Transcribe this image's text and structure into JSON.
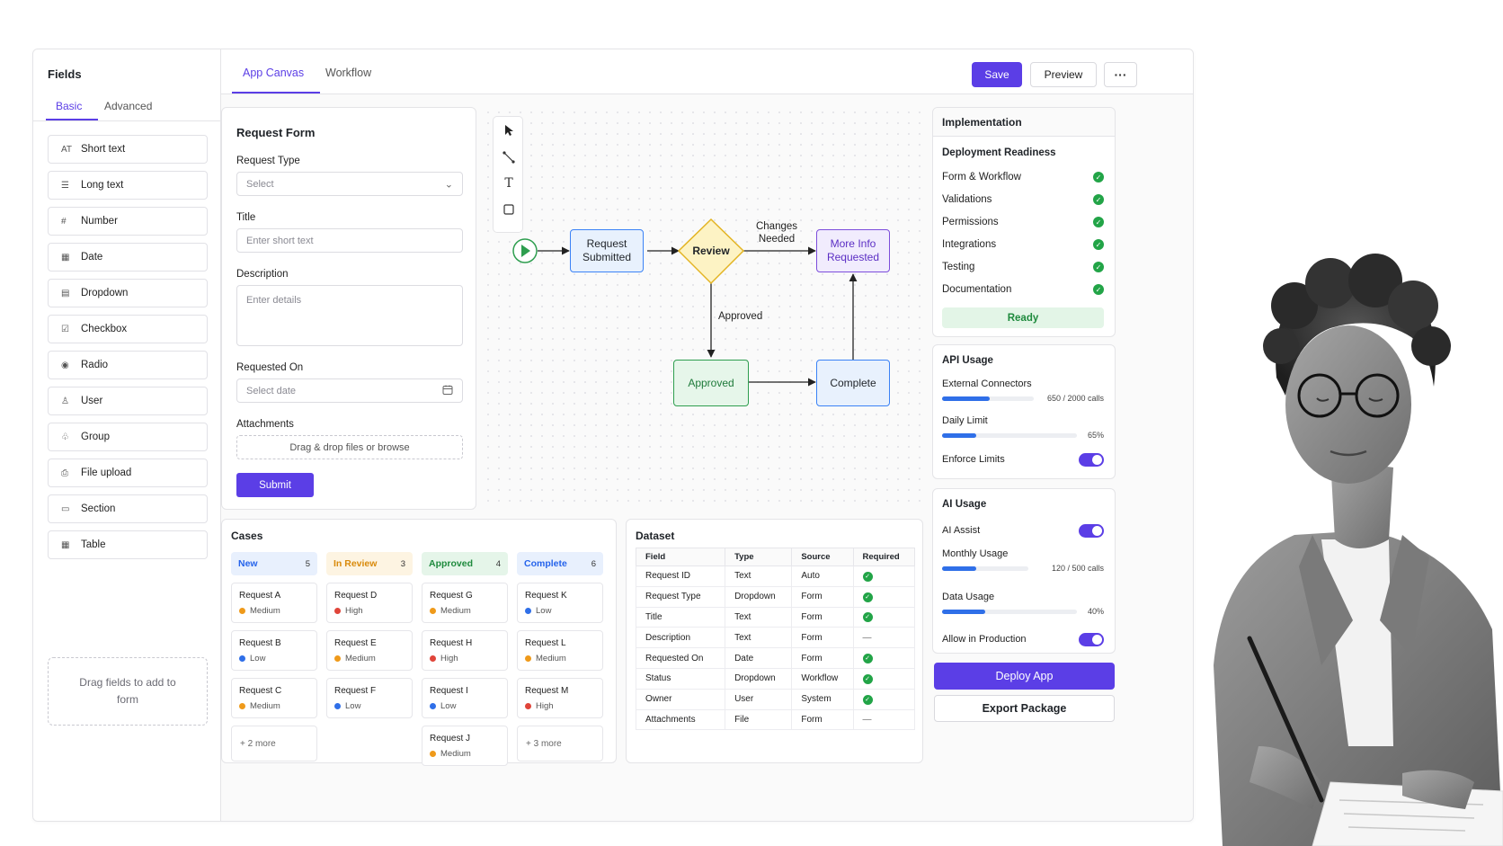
{
  "sidebar": {
    "title": "Fields",
    "tabs": [
      {
        "label": "Basic"
      },
      {
        "label": "Advanced"
      }
    ],
    "fields": [
      {
        "icon": "AT",
        "label": "Short text"
      },
      {
        "icon": "☰",
        "label": "Long text"
      },
      {
        "icon": "#",
        "label": "Number"
      },
      {
        "icon": "▦",
        "label": "Date"
      },
      {
        "icon": "▤",
        "label": "Dropdown"
      },
      {
        "icon": "☑",
        "label": "Checkbox"
      },
      {
        "icon": "◉",
        "label": "Radio"
      },
      {
        "icon": "♙",
        "label": "User"
      },
      {
        "icon": "♧",
        "label": "Group"
      },
      {
        "icon": "⎙",
        "label": "File upload"
      },
      {
        "icon": "▭",
        "label": "Section"
      },
      {
        "icon": "▦",
        "label": "Table"
      }
    ],
    "drop_zone": "Drag fields to add to form"
  },
  "header": {
    "tabs": [
      {
        "label": "App Canvas"
      },
      {
        "label": "Workflow"
      }
    ],
    "save_label": "Save",
    "preview_label": "Preview",
    "more_label": "···"
  },
  "form": {
    "title": "Request Form",
    "request_type": {
      "label": "Request Type",
      "placeholder": "Select"
    },
    "title_field": {
      "label": "Title",
      "placeholder": "Enter short text"
    },
    "description": {
      "label": "Description",
      "placeholder": "Enter details"
    },
    "requested_on": {
      "label": "Requested On",
      "placeholder": "Select date"
    },
    "attachments": {
      "label": "Attachments",
      "placeholder": "Drag & drop files or browse"
    },
    "submit_label": "Submit"
  },
  "workflow": {
    "nodes": {
      "submitted": "Request Submitted",
      "review": "Review",
      "more_info": "More Info Requested",
      "approved": "Approved",
      "complete": "Complete"
    },
    "edges": {
      "changes_needed": "Changes Needed",
      "approved": "Approved"
    },
    "colors": {
      "blue_fill": "#e8f1fd",
      "blue_stroke": "#3b82f6",
      "yellow_fill": "#fdf3c4",
      "yellow_stroke": "#e3b423",
      "purple_fill": "#f1ecfd",
      "purple_stroke": "#7c4ddb",
      "green_fill": "#e6f6ea",
      "green_stroke": "#2e9e4f"
    }
  },
  "implementation": {
    "title": "Implementation",
    "readiness_title": "Deployment Readiness",
    "checks": [
      {
        "label": "Form & Workflow"
      },
      {
        "label": "Validations"
      },
      {
        "label": "Permissions"
      },
      {
        "label": "Integrations"
      },
      {
        "label": "Testing"
      },
      {
        "label": "Documentation"
      }
    ],
    "status": "Ready"
  },
  "api_usage": {
    "title": "API Usage",
    "external": {
      "label": "External Connectors",
      "value": "650 / 2000 calls",
      "fraction": 0.52
    },
    "daily": {
      "label": "Daily Limit",
      "value": "65%",
      "fraction": 0.25
    },
    "enforce": {
      "label": "Enforce Limits",
      "on": true
    }
  },
  "ai_usage": {
    "title": "AI Usage",
    "assist": {
      "label": "AI Assist",
      "on": true
    },
    "monthly": {
      "label": "Monthly Usage",
      "value": "120 / 500 calls",
      "fraction": 0.4
    },
    "data": {
      "label": "Data Usage",
      "value": "40%",
      "fraction": 0.32
    },
    "production": {
      "label": "Allow in Production",
      "on": true
    }
  },
  "actions": {
    "deploy_label": "Deploy App",
    "export_label": "Export Package"
  },
  "cases": {
    "title": "Cases",
    "columns": [
      {
        "name": "New",
        "count": "5",
        "color": "#2563eb",
        "bg": "#e8f0fd",
        "cards": [
          {
            "title": "Request A",
            "priority": "Medium"
          },
          {
            "title": "Request B",
            "priority": "Low"
          },
          {
            "title": "Request C",
            "priority": "Medium"
          }
        ],
        "more": "+ 2 more"
      },
      {
        "name": "In Review",
        "count": "3",
        "color": "#d98a0b",
        "bg": "#fdf4e2",
        "cards": [
          {
            "title": "Request D",
            "priority": "High"
          },
          {
            "title": "Request E",
            "priority": "Medium"
          },
          {
            "title": "Request F",
            "priority": "Low"
          }
        ],
        "more": ""
      },
      {
        "name": "Approved",
        "count": "4",
        "color": "#1e8a3d",
        "bg": "#e5f5e9",
        "cards": [
          {
            "title": "Request G",
            "priority": "Medium"
          },
          {
            "title": "Request H",
            "priority": "High"
          },
          {
            "title": "Request I",
            "priority": "Low"
          },
          {
            "title": "Request J",
            "priority": "Medium"
          }
        ],
        "more": ""
      },
      {
        "name": "Complete",
        "count": "6",
        "color": "#2563eb",
        "bg": "#e8f0fd",
        "cards": [
          {
            "title": "Request K",
            "priority": "Low"
          },
          {
            "title": "Request L",
            "priority": "Medium"
          },
          {
            "title": "Request M",
            "priority": "High"
          }
        ],
        "more": "+ 3 more"
      }
    ],
    "priority_colors": {
      "High": "#e0453a",
      "Medium": "#ef9a1a",
      "Low": "#2f6fe8"
    }
  },
  "dataset": {
    "title": "Dataset",
    "headers": [
      "Field",
      "Type",
      "Source",
      "Required"
    ],
    "rows": [
      {
        "field": "Request ID",
        "type": "Text",
        "source": "Auto",
        "required": true
      },
      {
        "field": "Request Type",
        "type": "Dropdown",
        "source": "Form",
        "required": true
      },
      {
        "field": "Title",
        "type": "Text",
        "source": "Form",
        "required": true
      },
      {
        "field": "Description",
        "type": "Text",
        "source": "Form",
        "required": false
      },
      {
        "field": "Requested On",
        "type": "Date",
        "source": "Form",
        "required": true
      },
      {
        "field": "Status",
        "type": "Dropdown",
        "source": "Workflow",
        "required": true
      },
      {
        "field": "Owner",
        "type": "User",
        "source": "System",
        "required": true
      },
      {
        "field": "Attachments",
        "type": "File",
        "source": "Form",
        "required": false
      }
    ]
  },
  "colors": {
    "accent": "#5b3ee6",
    "success": "#22a447"
  }
}
